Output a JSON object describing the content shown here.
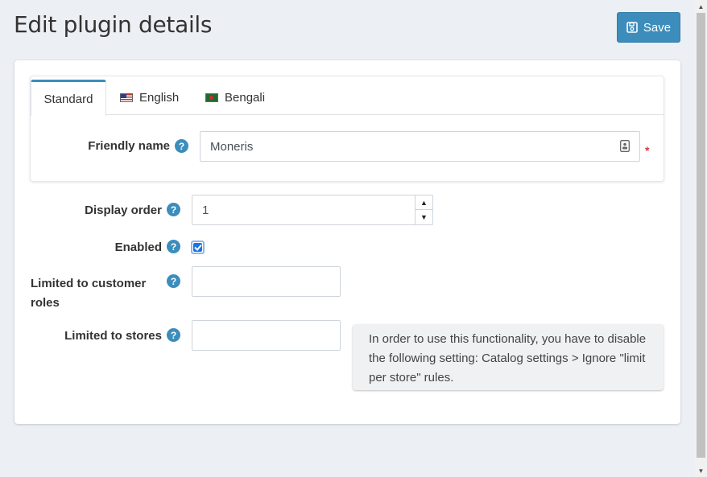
{
  "header": {
    "title": "Edit plugin details",
    "save_label": "Save"
  },
  "tabs": [
    {
      "label": "Standard",
      "active": true
    },
    {
      "label": "English",
      "flag": "us-flag-icon"
    },
    {
      "label": "Bengali",
      "flag": "bd-flag-icon"
    }
  ],
  "form": {
    "friendly_name": {
      "label": "Friendly name",
      "value": "Moneris",
      "required_mark": "*"
    },
    "display_order": {
      "label": "Display order",
      "value": "1"
    },
    "enabled": {
      "label": "Enabled",
      "checked": true
    },
    "customer_roles": {
      "label": "Limited to customer roles",
      "value": ""
    },
    "stores": {
      "label": "Limited to stores",
      "value": ""
    }
  },
  "info": {
    "text": "In order to use this functionality, you have to disable the following setting: Catalog settings > Ignore \"limit per store\" rules."
  },
  "colors": {
    "accent": "#3c8dbc",
    "help_icon": "#3c8dbc",
    "required": "#dc3545",
    "checkbox": "#1a73e8"
  }
}
